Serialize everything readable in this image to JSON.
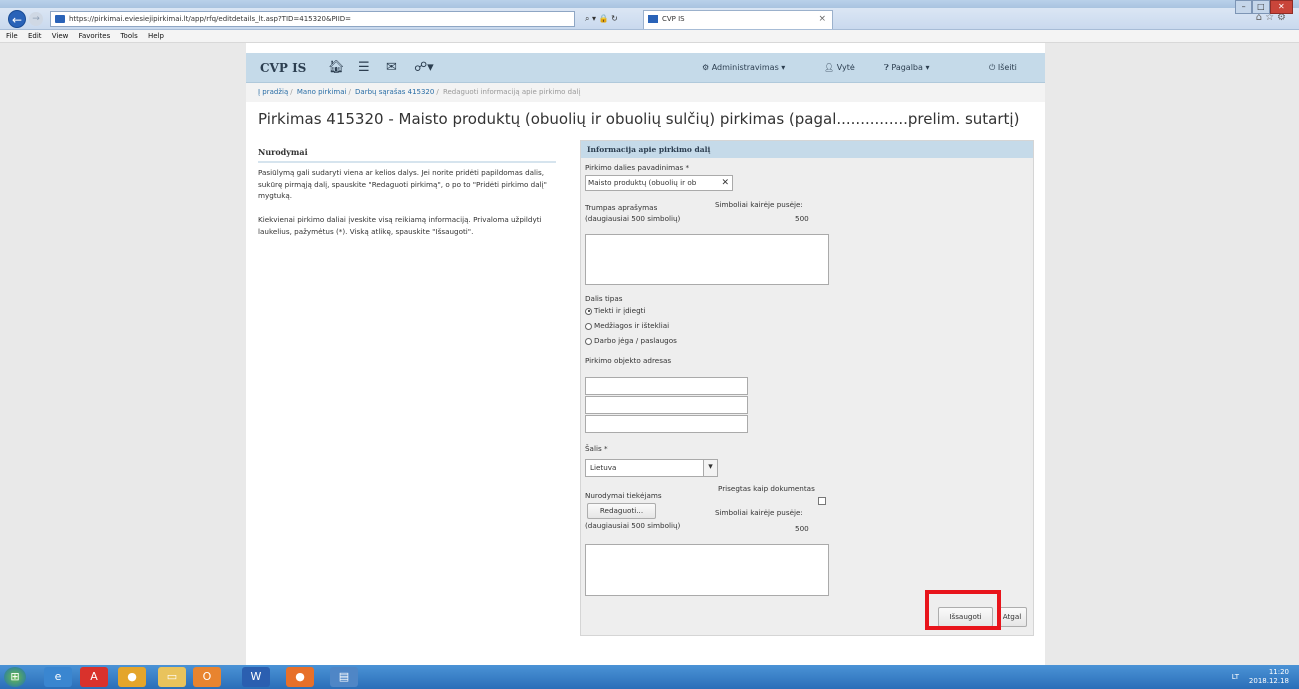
{
  "browser": {
    "url": "https://pirkimai.eviesiejipirkimai.lt/app/rfq/editdetails_lt.asp?TID=415320&PIID=",
    "tab_title": "CVP IS",
    "menu": [
      "File",
      "Edit",
      "View",
      "Favorites",
      "Tools",
      "Help"
    ]
  },
  "navbar": {
    "brand": "CVP IS",
    "admin": "Administravimas",
    "user": "Vytė",
    "help": "Pagalba",
    "logout": "Išeiti"
  },
  "breadcrumb": [
    "Į pradžią",
    "Mano pirkimai",
    "Darbų sąrašas 415320",
    "Redaguoti informaciją apie pirkimo dalį"
  ],
  "page_title": "Pirkimas  415320 - Maisto produktų (obuolių ir obuolių sulčių) pirkimas (pagal...............prelim. sutartį)",
  "instructions": {
    "heading": "Nurodymai",
    "p1": "Pasiūlymą gali sudaryti viena ar kelios dalys. Jei norite pridėti papildomas dalis, sukūrę pirmąją dalį, spauskite \"Redaguoti pirkimą\", o po to \"Pridėti pirkimo dalį\" mygtuką.",
    "p2": "Kiekvienai pirkimo daliai įveskite visą reikiamą informaciją. Privaloma užpildyti laukelius, pažymėtus (*). Viską atlikę, spauskite \"Išsaugoti\"."
  },
  "form": {
    "panel_title": "Informacija apie pirkimo dalį",
    "name_label": "Pirkimo dalies pavadinimas *",
    "name_value": "Maisto produktų (obuolių ir ob",
    "desc_label1": "Trumpas aprašymas",
    "desc_label2": "(daugiausiai 500 simbolių)",
    "chars_left_label": "Simboliai kairėje pusėje:",
    "chars_left_value": "500",
    "type_label": "Dalis tipas",
    "type_options": [
      "Tiekti ir įdiegti",
      "Medžiagos ir ištekliai",
      "Darbo jėga / paslaugos"
    ],
    "address_label": "Pirkimo objekto adresas",
    "country_label": "Šalis *",
    "country_value": "Lietuva",
    "attached_label": "Prisegtas kaip dokumentas",
    "supplier_label": "Nurodymai tiekėjams",
    "edit_button": "Redaguoti...",
    "supplier_limit": "(daugiausiai 500 simbolių)",
    "chars_left_label2": "Simboliai kairėje pusėje:",
    "chars_left_value2": "500",
    "save_button": "Išsaugoti",
    "back_button": "Atgal"
  },
  "taskbar": {
    "lang": "LT",
    "time": "11:20",
    "date": "2018.12.18"
  }
}
